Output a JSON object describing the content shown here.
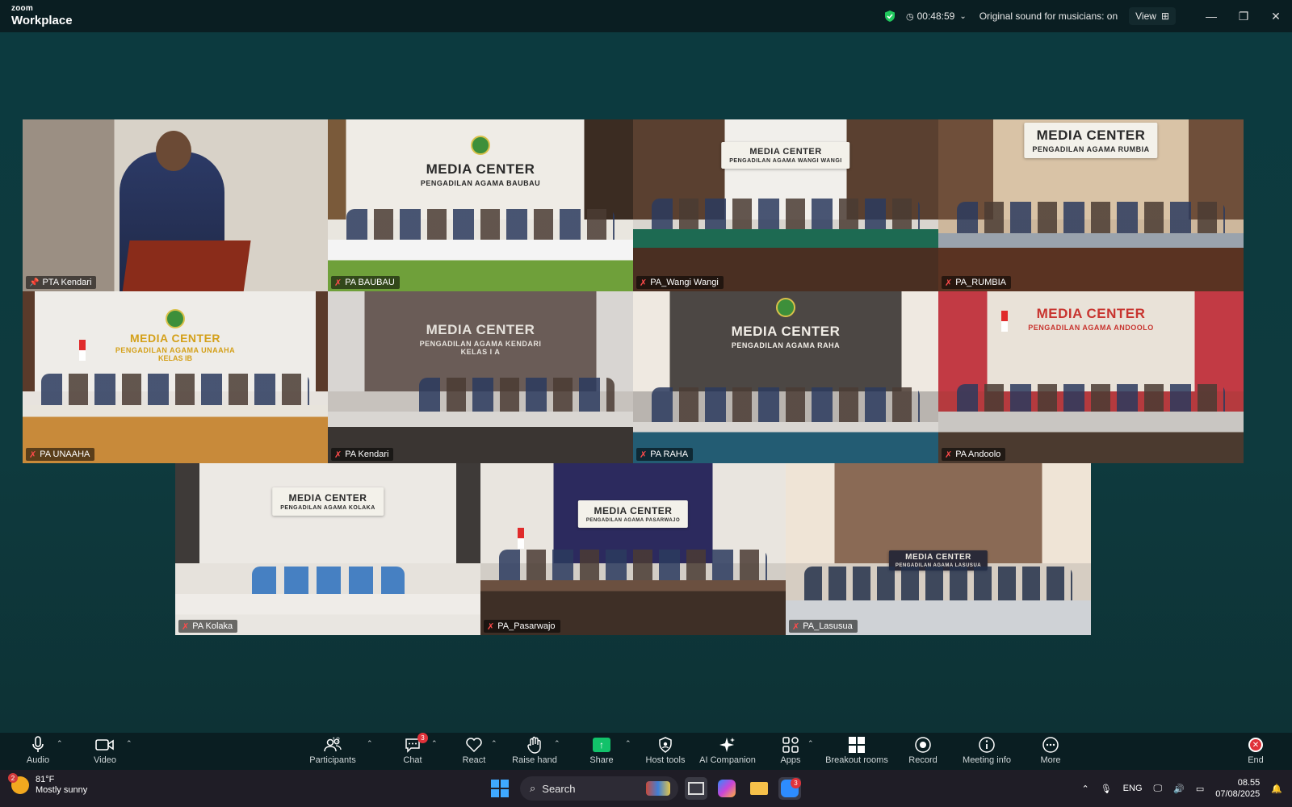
{
  "app": {
    "brand_small": "zoom",
    "brand_big": "Workplace",
    "timer": "00:48:59",
    "original_sound": "Original sound for musicians: on",
    "view_label": "View"
  },
  "tiles": [
    {
      "name": "PTA Kendari",
      "sign1": "",
      "sign2": "",
      "sign3": "",
      "active": true
    },
    {
      "name": "PA BAUBAU",
      "sign1": "MEDIA CENTER",
      "sign2": "PENGADILAN AGAMA BAUBAU",
      "sign3": ""
    },
    {
      "name": "PA_Wangi Wangi",
      "sign1": "MEDIA CENTER",
      "sign2": "PENGADILAN AGAMA WANGI WANGI",
      "sign3": ""
    },
    {
      "name": "PA_RUMBIA",
      "sign1": "MEDIA CENTER",
      "sign2": "PENGADILAN AGAMA RUMBIA",
      "sign3": ""
    },
    {
      "name": "PA UNAAHA",
      "sign1": "MEDIA CENTER",
      "sign2": "PENGADILAN AGAMA UNAAHA",
      "sign3": "KELAS IB"
    },
    {
      "name": "PA Kendari",
      "sign1": "MEDIA CENTER",
      "sign2": "PENGADILAN AGAMA KENDARI KELAS I A",
      "sign3": ""
    },
    {
      "name": "PA RAHA",
      "sign1": "MEDIA CENTER",
      "sign2": "PENGADILAN AGAMA RAHA",
      "sign3": ""
    },
    {
      "name": "PA Andoolo",
      "sign1": "MEDIA CENTER",
      "sign2": "PENGADILAN AGAMA ANDOOLO",
      "sign3": ""
    },
    {
      "name": "PA Kolaka",
      "sign1": "MEDIA CENTER",
      "sign2": "PENGADILAN AGAMA KOLAKA",
      "sign3": ""
    },
    {
      "name": "PA_Pasarwajo",
      "sign1": "MEDIA CENTER",
      "sign2": "PENGADILAN AGAMA PASARWAJO",
      "sign3": ""
    },
    {
      "name": "PA_Lasusua",
      "sign1": "MEDIA CENTER",
      "sign2": "PENGADILAN AGAMA LASUSUA",
      "sign3": ""
    }
  ],
  "toolbar": {
    "audio": "Audio",
    "video": "Video",
    "participants": "Participants",
    "participants_count": "12",
    "chat": "Chat",
    "chat_badge": "3",
    "react": "React",
    "raise_hand": "Raise hand",
    "share": "Share",
    "host_tools": "Host tools",
    "ai_companion": "AI Companion",
    "apps": "Apps",
    "breakout_rooms": "Breakout rooms",
    "record": "Record",
    "meeting_info": "Meeting info",
    "more": "More",
    "end": "End"
  },
  "taskbar": {
    "weather_badge": "2",
    "temperature": "81°F",
    "condition": "Mostly sunny",
    "search": "Search",
    "zoom_badge": "3",
    "lang": "ENG",
    "time": "08.55",
    "date": "07/08/2025"
  },
  "colors": {
    "stage": "#0c3a3f",
    "active_outline": "#4fe38b",
    "share_green": "#12c26a",
    "end_red": "#e0323a"
  }
}
